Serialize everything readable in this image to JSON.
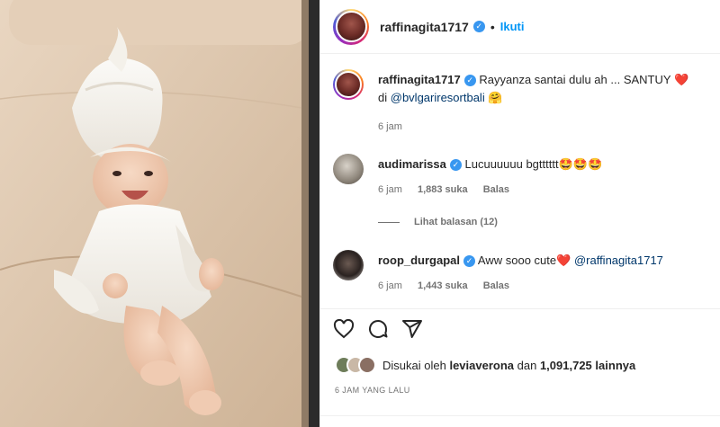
{
  "post": {
    "username": "raffinagita1717",
    "follow_label": "Ikuti",
    "dot": "•",
    "caption_text": "Rayyanza santai dulu ah ... SANTUY",
    "caption_heart": "❤️",
    "caption_location_prefix": "di",
    "caption_mention": "@bvlgariresortbali",
    "caption_emoji": "🤗",
    "caption_time": "6 jam"
  },
  "comments": [
    {
      "username": "audimarissa",
      "text": "Lucuuuuuu bgtttttt",
      "emoji": "🤩🤩🤩",
      "time": "6 jam",
      "likes": "1,883 suka",
      "reply": "Balas"
    },
    {
      "username": "roop_durgapal",
      "text": "Aww sooo cute",
      "emoji": "❤️",
      "mention": "@raffinagita1717",
      "time": "6 jam",
      "likes": "1,443 suka",
      "reply": "Balas"
    }
  ],
  "view_replies": "Lihat balasan (12)",
  "likes": {
    "prefix": "Disukai oleh",
    "user": "leviaverona",
    "middle": "dan",
    "count": "1,091,725",
    "suffix": "lainnya"
  },
  "date": "6 JAM YANG LALU",
  "icons": [
    "heart-icon",
    "comment-icon",
    "share-icon"
  ],
  "colors": {
    "accent": "#0095f6",
    "verified": "#3897f0",
    "mention": "#00376b",
    "muted": "#737373"
  }
}
